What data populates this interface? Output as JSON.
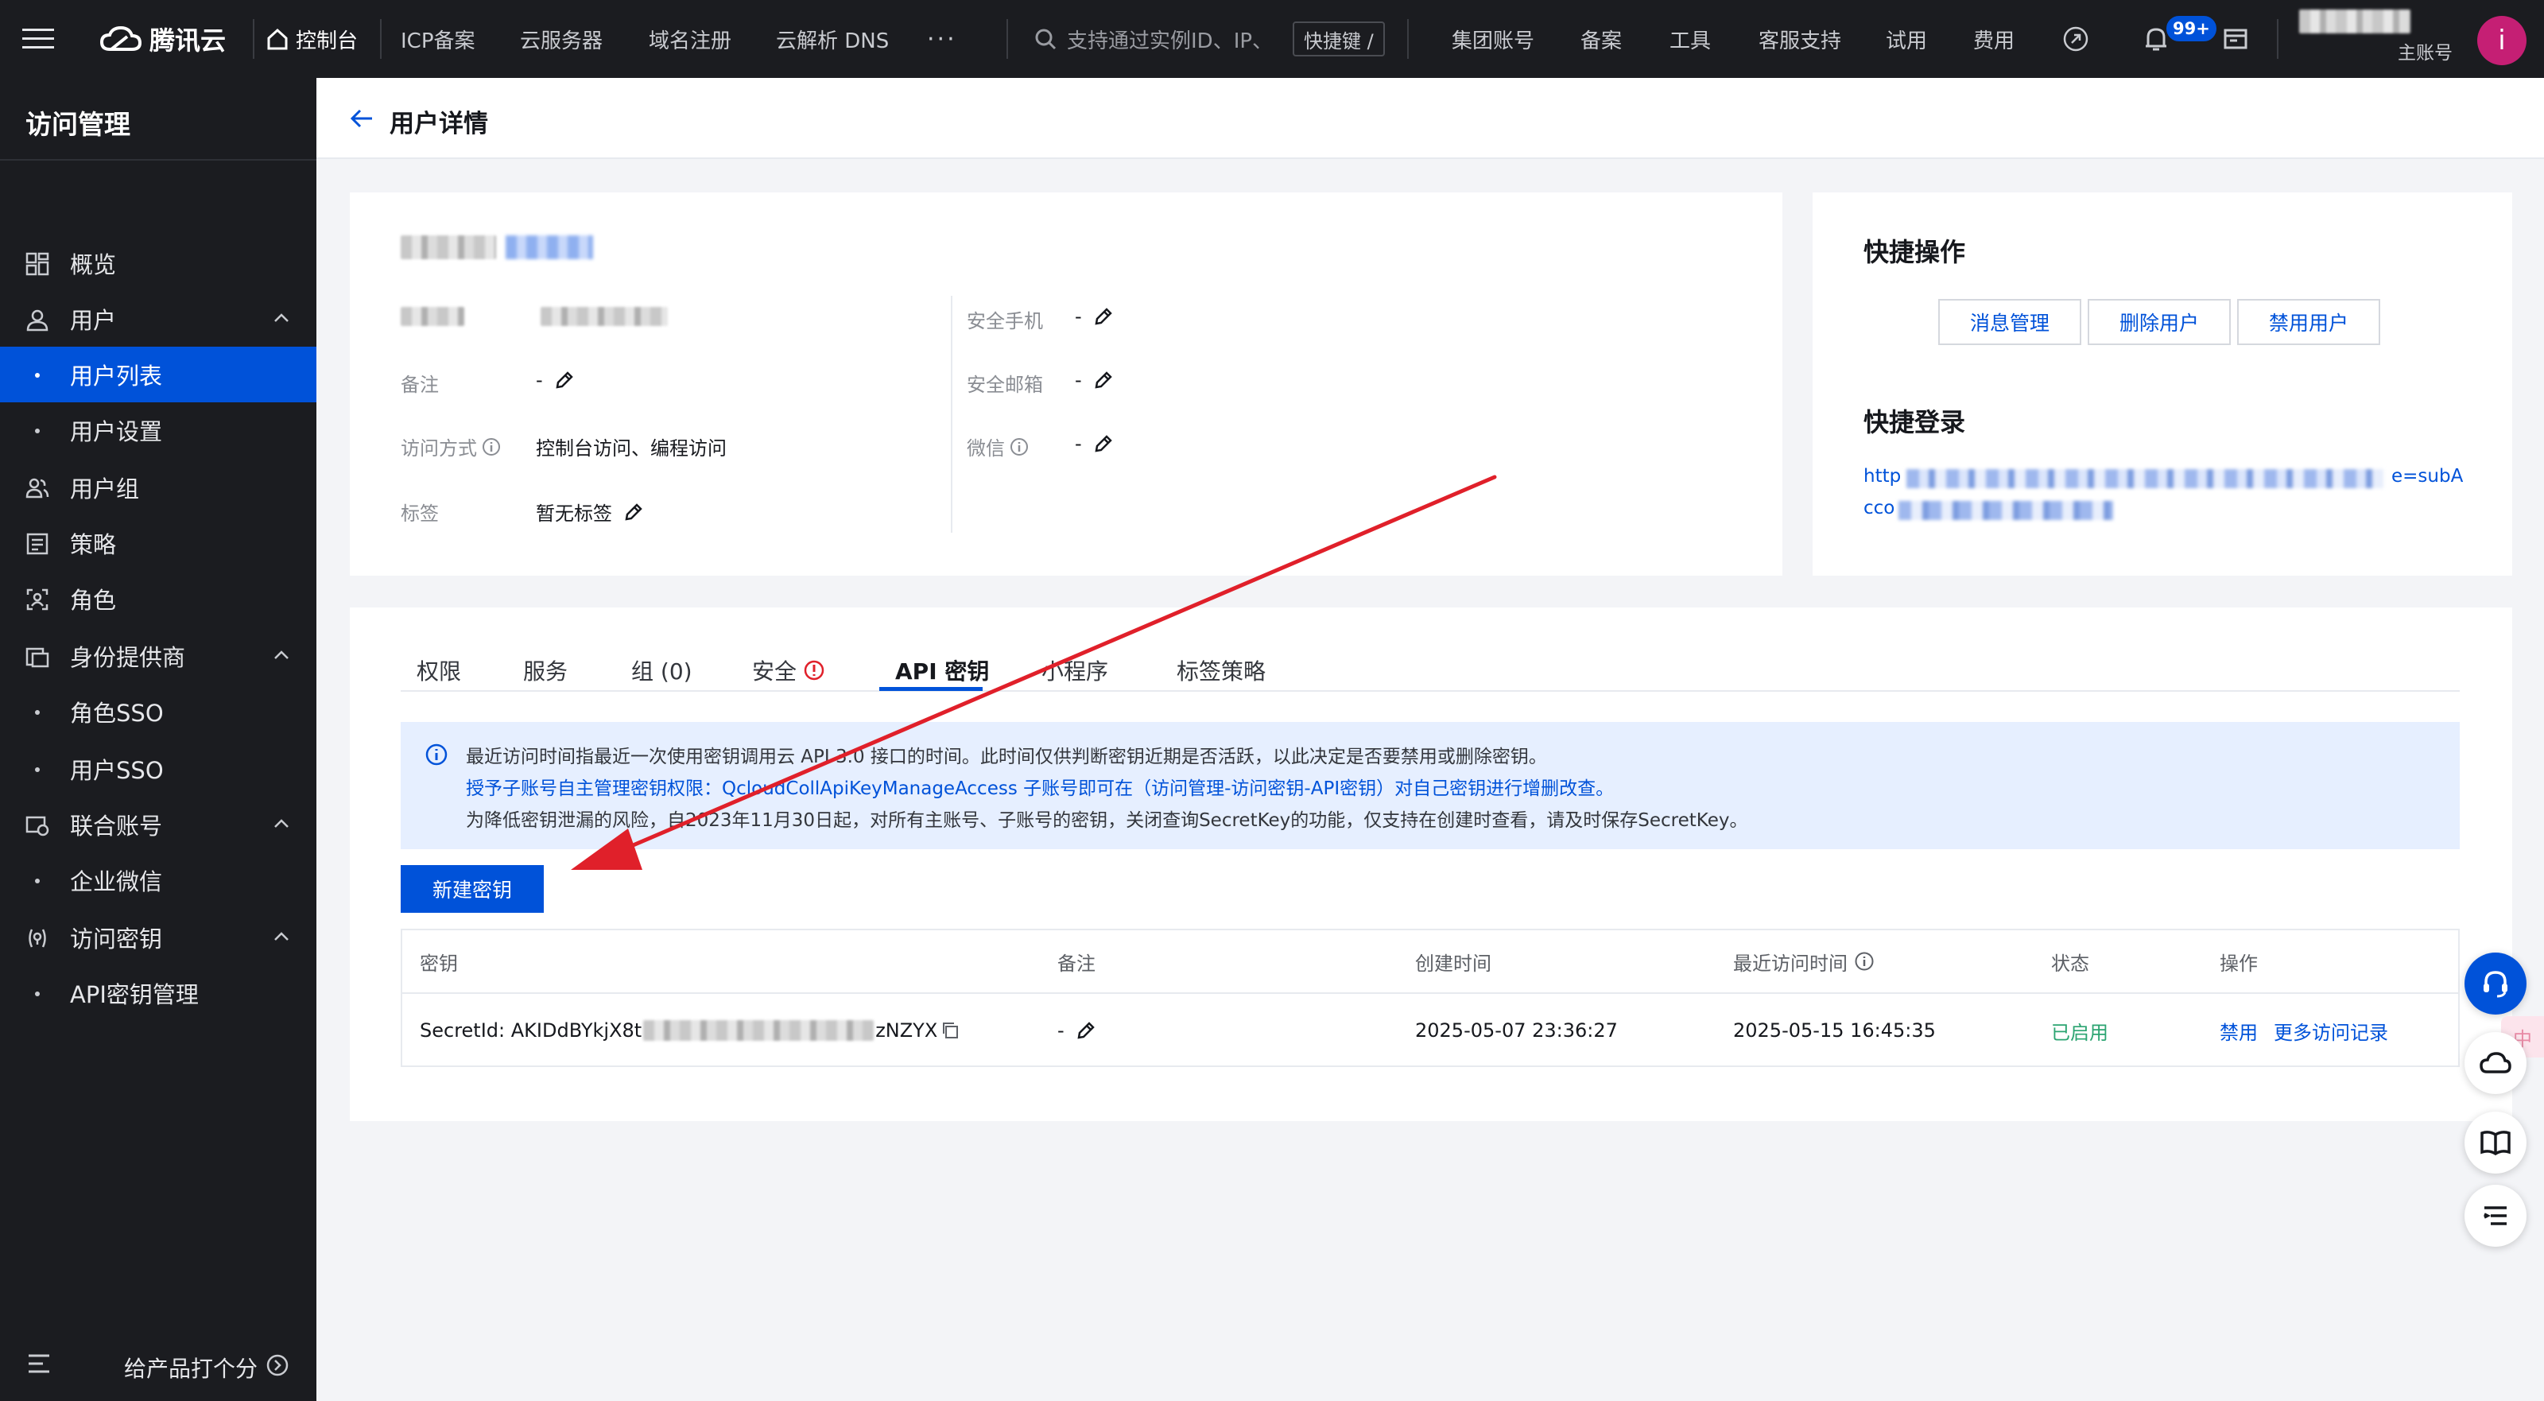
{
  "topbar": {
    "brand": "腾讯云",
    "console": "控制台",
    "nav": [
      "ICP备案",
      "云服务器",
      "域名注册",
      "云解析 DNS"
    ],
    "more": "···",
    "search_placeholder": "支持通过实例ID、IP、",
    "shortcut_key": "快捷键 /",
    "right_links": [
      "集团账号",
      "备案",
      "工具",
      "客服支持",
      "试用",
      "费用"
    ],
    "notification_badge": "99+",
    "account_role": "主账号",
    "avatar_letter": "i"
  },
  "sidebar": {
    "title": "访问管理",
    "items": [
      {
        "label": "概览",
        "icon": "dashboard-icon"
      },
      {
        "label": "用户",
        "icon": "user-icon",
        "expanded": true
      },
      {
        "label": "用户列表",
        "sub": true,
        "active": true
      },
      {
        "label": "用户设置",
        "sub": true
      },
      {
        "label": "用户组",
        "icon": "user-group-icon"
      },
      {
        "label": "策略",
        "icon": "policy-icon"
      },
      {
        "label": "角色",
        "icon": "role-icon"
      },
      {
        "label": "身份提供商",
        "icon": "identity-provider-icon",
        "expanded": true
      },
      {
        "label": "角色SSO",
        "sub": true
      },
      {
        "label": "用户SSO",
        "sub": true
      },
      {
        "label": "联合账号",
        "icon": "federated-account-icon",
        "expanded": true
      },
      {
        "label": "企业微信",
        "sub": true
      },
      {
        "label": "访问密钥",
        "icon": "access-key-icon",
        "expanded": true
      },
      {
        "label": "API密钥管理",
        "sub": true
      }
    ],
    "feedback": "给产品打个分"
  },
  "page": {
    "title": "用户详情"
  },
  "user_info": {
    "left_fields": [
      {
        "label": "备注",
        "value": "-"
      },
      {
        "label": "访问方式",
        "value": "控制台访问、编程访问"
      },
      {
        "label": "标签",
        "value": "暂无标签"
      }
    ],
    "right_fields": [
      {
        "label": "安全手机",
        "value": "-"
      },
      {
        "label": "安全邮箱",
        "value": "-"
      },
      {
        "label": "微信",
        "value": "-"
      }
    ]
  },
  "quick_actions": {
    "title": "快捷操作",
    "buttons": [
      "消息管理",
      "删除用户",
      "禁用用户"
    ],
    "login_title": "快捷登录",
    "login_url_start": "http",
    "login_url_end": "e=subA",
    "login_url_line2": "cco"
  },
  "tabs": {
    "items": [
      "权限",
      "服务",
      "组 (0)",
      "安全",
      "API 密钥",
      "小程序",
      "标签策略"
    ],
    "active_index": 4
  },
  "notice": {
    "line1": "最近访问时间指最近一次使用密钥调用云 API 3.0 接口的时间。此时间仅供判断密钥近期是否活跃，以此决定是否要禁用或删除密钥。",
    "line2": "授予子账号自主管理密钥权限：QcloudCollApiKeyManageAccess 子账号即可在（访问管理-访问密钥-API密钥）对自己密钥进行增删改查。",
    "line3": "为降低密钥泄漏的风险，自2023年11月30日起，对所有主账号、子账号的密钥，关闭查询SecretKey的功能，仅支持在创建时查看，请及时保存SecretKey。"
  },
  "create_key_button": "新建密钥",
  "key_table": {
    "columns": [
      "密钥",
      "备注",
      "创建时间",
      "最近访问时间",
      "状态",
      "操作"
    ],
    "rows": [
      {
        "secret_id_prefix": "SecretId: AKIDdBYkjX8t",
        "secret_id_suffix": "zNZYX",
        "remark": "-",
        "created": "2025-05-07 23:36:27",
        "last_access": "2025-05-15 16:45:35",
        "status": "已启用",
        "actions": [
          "禁用",
          "更多访问记录"
        ]
      }
    ]
  },
  "colors": {
    "topbar_bg": "#1b1c20",
    "primary": "#0052d9",
    "page_bg": "#f3f4f7",
    "notice_bg": "#e6efff",
    "status_green": "#2ba471",
    "annotation_arrow": "#e0202a",
    "avatar_bg": "#c51f74"
  },
  "side_floats": [
    "customer-service-icon",
    "lang-switch-icon",
    "cloud-icon",
    "book-icon",
    "list-icon"
  ]
}
